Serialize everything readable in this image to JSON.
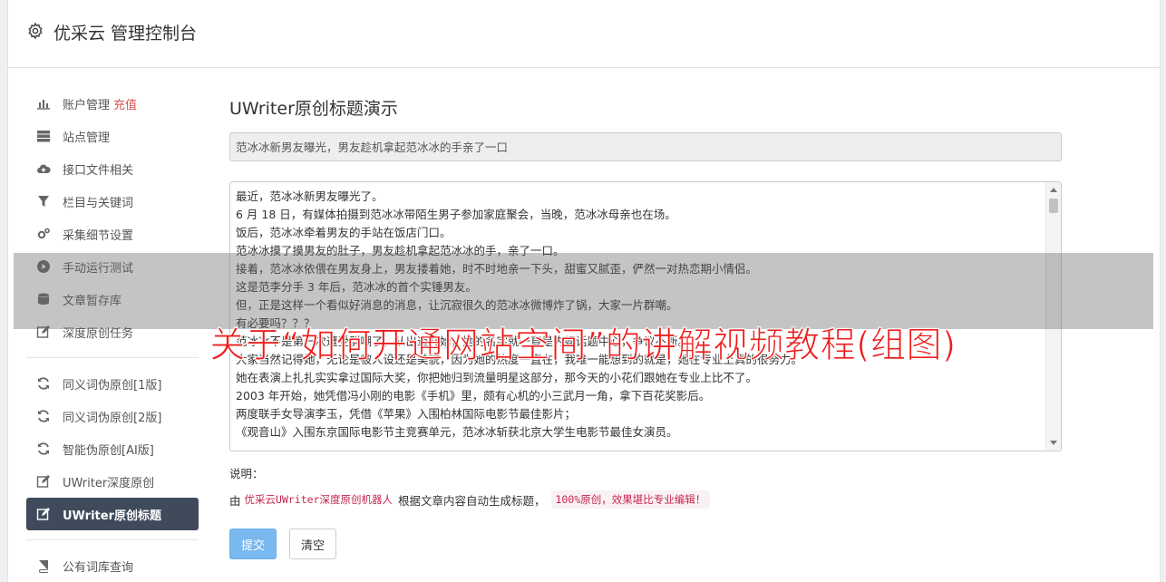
{
  "header": {
    "title": "优采云 管理控制台"
  },
  "sidebar": {
    "items": [
      {
        "label": "账户管理",
        "badge": "充值",
        "icon": "bar-chart-icon"
      },
      {
        "label": "站点管理",
        "icon": "server-icon"
      },
      {
        "label": "接口文件相关",
        "icon": "cloud-upload-icon"
      },
      {
        "label": "栏目与关键词",
        "icon": "filter-icon"
      },
      {
        "label": "采集细节设置",
        "icon": "gears-icon"
      },
      {
        "label": "手动运行测试",
        "icon": "play-icon"
      },
      {
        "label": "文章暂存库",
        "icon": "database-icon"
      },
      {
        "label": "深度原创任务",
        "icon": "edit-icon"
      },
      {
        "label": "同义词伪原创[1版]",
        "icon": "refresh-icon"
      },
      {
        "label": "同义词伪原创[2版]",
        "icon": "refresh-icon"
      },
      {
        "label": "智能伪原创[AI版]",
        "icon": "refresh-icon"
      },
      {
        "label": "UWriter深度原创",
        "icon": "edit-icon"
      },
      {
        "label": "UWriter原创标题",
        "icon": "edit-icon",
        "active": true
      },
      {
        "label": "公有词库查询",
        "icon": "book-icon"
      }
    ]
  },
  "main": {
    "title": "UWriter原创标题演示",
    "title_value": "范冰冰新男友曝光，男友趁机拿起范冰冰的手亲了一口",
    "article_lines": [
      "最近，范冰冰新男友曝光了。",
      "6 月 18 日，有媒体拍摄到范冰冰带陌生男子参加家庭聚会，当晚，范冰冰母亲也在场。",
      "饭后，范冰冰牵着男友的手站在饭店门口。",
      "范冰冰摸了摸男友的肚子，男友趁机拿起范冰冰的手，亲了一口。",
      "接着，范冰冰依偎在男友身上，男友搂着她，时不时地亲一下头，甜蜜又腻歪，俨然一对热恋期小情侣。",
      "这是范李分手 3 年后，范冰冰的首个实锤男友。",
      "但，正是这样一个看似好消息的消息，让沉寂很久的范冰冰微博炸了锅，大家一片群嘲。",
      "有必要吗？？？",
      "范冰冰不是第一次遭受群嘲了，从出道开始，她的名字就一直是内娱话题中心，争议不断。",
      "大家当然记得她，无论是被人设还是美貌，因为她的热度一直在，我唯一能想到的就是，她在专业上真的很努力。",
      "她在表演上扎扎实实拿过国际大奖，你把她归到流量明星这部分，那今天的小花们跟她在专业上比不了。",
      "2003 年开始，她凭借冯小刚的电影《手机》里，颇有心机的小三武月一角，拿下百花奖影后。",
      "两度联手女导演李玉，凭借《苹果》入围柏林国际电影节最佳影片；",
      "《观音山》入围东京国际电影节主竞赛单元，范冰冰斩获北京大学生电影节最佳女演员。"
    ],
    "explain_label": "说明：",
    "explain_prefix": "由",
    "explain_code1": "优采云UWriter深度原创机器人",
    "explain_middle": "根据文章内容自动生成标题，",
    "explain_code2": "100%原创，效果堪比专业编辑！",
    "submit_label": "提交",
    "clear_label": "清空"
  },
  "overlay": {
    "text": "关于“如何开通网站空间”的讲解视频教程(组图)"
  },
  "colors": {
    "active_nav": "#3f4b5b",
    "primary": "#7ab8f0",
    "accent_red": "#d9534f",
    "overlay_text": "#ee1c1c"
  }
}
